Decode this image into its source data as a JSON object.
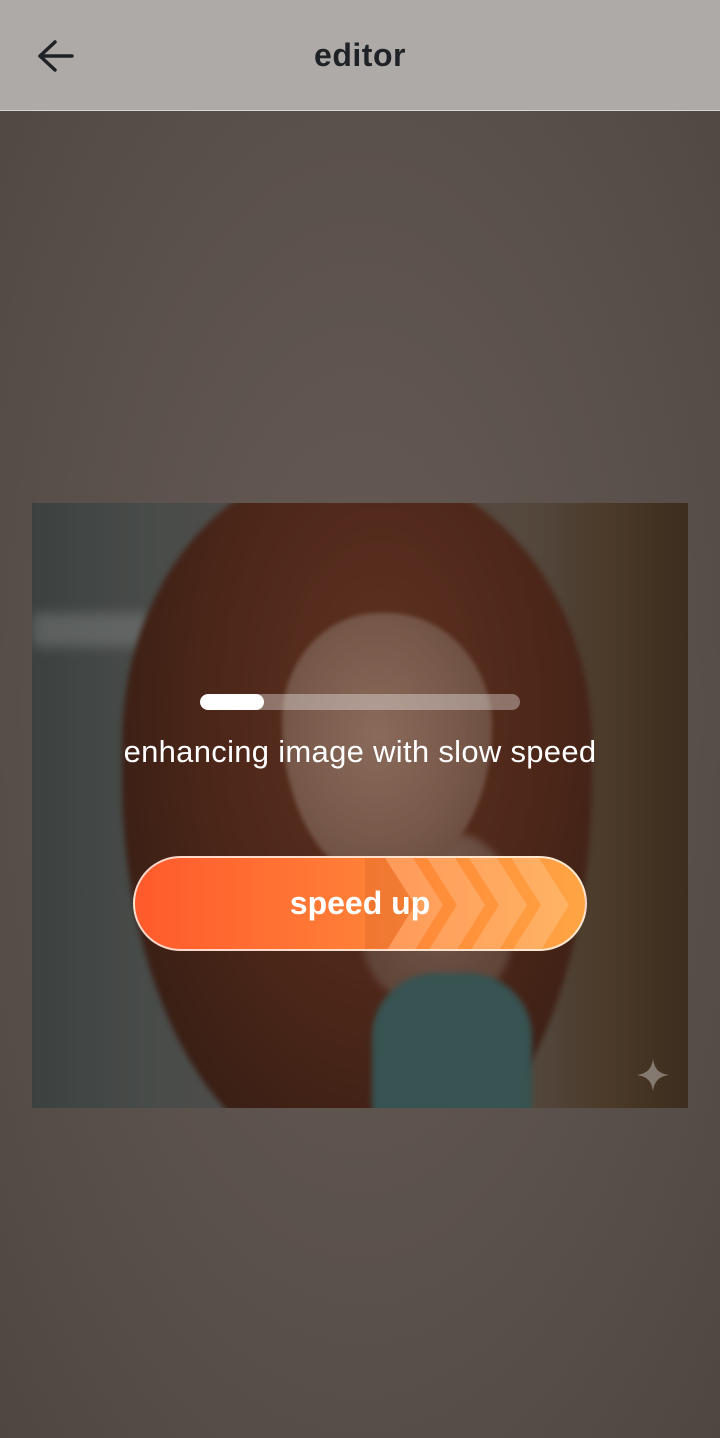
{
  "topbar": {
    "title": "editor",
    "back_icon": "arrow-left-icon"
  },
  "enhance": {
    "progress": 0.2,
    "status_text": "enhancing image with slow speed",
    "speed_up_label": "speed up",
    "sparkle_icon": "sparkle-icon"
  },
  "colors": {
    "topbar_bg": "#aeaaa7",
    "button_start": "#ff5a2c",
    "button_end": "#ffa544",
    "text_light": "#ffffff",
    "title_text": "#1f2226"
  }
}
